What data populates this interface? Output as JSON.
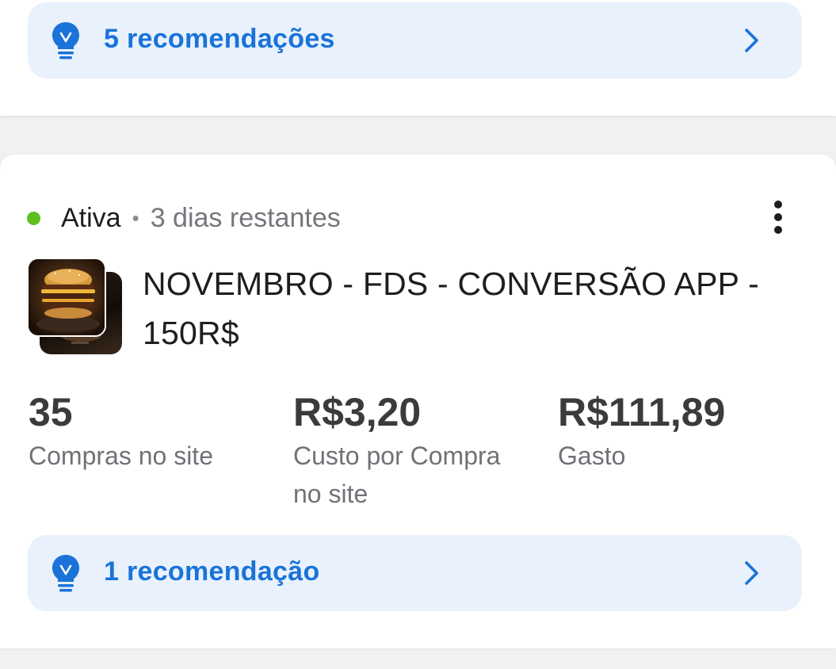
{
  "top_card": {
    "recommendation_label": "5 recomendações",
    "icon": "lightbulb-icon"
  },
  "campaign": {
    "status": "Ativa",
    "status_color": "#5fbf1f",
    "separator": "•",
    "remaining": "3 dias restantes",
    "title": "NOVEMBRO - FDS - CONVERSÃO APP - 150R$",
    "thumbnail": "burger-ad-thumbnail",
    "metrics": [
      {
        "value": "35",
        "label": "Compras no site"
      },
      {
        "value": "R$3,20",
        "label": "Custo por Compra no site"
      },
      {
        "value": "R$111,89",
        "label": "Gasto"
      }
    ],
    "recommendation_label": "1 recomendação"
  },
  "colors": {
    "accent": "#1a73d8",
    "recommendation_bg": "#e8f1fc"
  }
}
